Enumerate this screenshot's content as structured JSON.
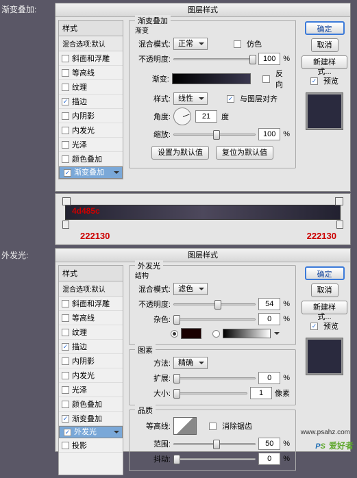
{
  "labels": {
    "grad": "渐变叠加:",
    "glow": "外发光:"
  },
  "dialog_title": "图层样式",
  "styles": {
    "head": "样式",
    "sub": "混合选项:默认",
    "items": [
      {
        "label": "斜面和浮雕",
        "chk": false
      },
      {
        "label": "等高线",
        "chk": false
      },
      {
        "label": "纹理",
        "chk": false
      },
      {
        "label": "描边",
        "chk": true
      },
      {
        "label": "内阴影",
        "chk": false
      },
      {
        "label": "内发光",
        "chk": false
      },
      {
        "label": "光泽",
        "chk": false
      },
      {
        "label": "颜色叠加",
        "chk": false
      },
      {
        "label": "渐变叠加",
        "chk": true,
        "sel": true
      }
    ]
  },
  "styles2": {
    "items": [
      {
        "label": "斜面和浮雕",
        "chk": false
      },
      {
        "label": "等高线",
        "chk": false
      },
      {
        "label": "纹理",
        "chk": false
      },
      {
        "label": "描边",
        "chk": true
      },
      {
        "label": "内阴影",
        "chk": false
      },
      {
        "label": "内发光",
        "chk": false
      },
      {
        "label": "光泽",
        "chk": false
      },
      {
        "label": "颜色叠加",
        "chk": false
      },
      {
        "label": "渐变叠加",
        "chk": true
      },
      {
        "label": "外发光",
        "chk": true,
        "sel": true
      },
      {
        "label": "投影",
        "chk": false
      }
    ]
  },
  "grad": {
    "title": "渐变叠加",
    "sub": "渐变",
    "blend_lbl": "混合模式:",
    "blend_val": "正常",
    "dither": "仿色",
    "opacity_lbl": "不透明度:",
    "opacity_val": "100",
    "pct": "%",
    "gradient_lbl": "渐变:",
    "reverse": "反向",
    "style_lbl": "样式:",
    "style_val": "线性",
    "align": "与图层对齐",
    "angle_lbl": "角度:",
    "angle_val": "21",
    "deg": "度",
    "scale_lbl": "缩放:",
    "scale_val": "100",
    "btn_default": "设置为默认值",
    "btn_reset": "复位为默认值"
  },
  "glow": {
    "title": "外发光",
    "struct": "结构",
    "blend_lbl": "混合模式:",
    "blend_val": "滤色",
    "opacity_lbl": "不透明度:",
    "opacity_val": "54",
    "pct": "%",
    "noise_lbl": "杂色:",
    "noise_val": "0",
    "elem": "图素",
    "method_lbl": "方法:",
    "method_val": "精确",
    "spread_lbl": "扩展:",
    "spread_val": "0",
    "size_lbl": "大小:",
    "size_val": "1",
    "px": "像素",
    "qual": "品质",
    "contour_lbl": "等高线:",
    "aa": "消除锯齿",
    "range_lbl": "范围:",
    "range_val": "50",
    "jitter_lbl": "抖动:",
    "jitter_val": "0"
  },
  "buttons": {
    "ok": "确定",
    "cancel": "取消",
    "new": "新建样式...",
    "preview": "预览"
  },
  "colors": {
    "mid": "4d485c",
    "side": "222130"
  },
  "watermark": {
    "p": "P",
    "s": "S",
    "cn": "爱好者",
    "url": "www.psahz.com"
  }
}
